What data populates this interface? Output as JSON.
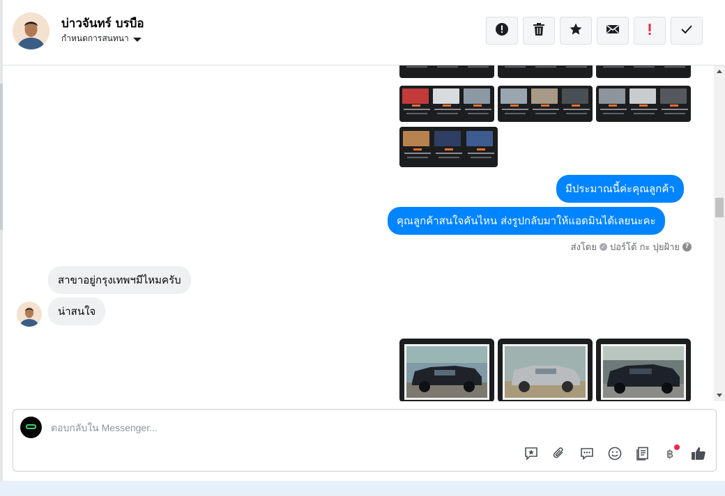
{
  "header": {
    "contact_name": "บ่าวจันทร์ บรบือ",
    "assign_label": "กำหนดการสนทนา",
    "tools": [
      {
        "name": "report-spam",
        "icon": "exclamation-circle-icon"
      },
      {
        "name": "delete",
        "icon": "trash-icon"
      },
      {
        "name": "star",
        "icon": "star-icon"
      },
      {
        "name": "mark-unread",
        "icon": "envelope-icon"
      },
      {
        "name": "follow-up",
        "icon": "red-exclamation-icon"
      },
      {
        "name": "mark-done",
        "icon": "checkmark-icon"
      }
    ]
  },
  "messages": {
    "outgoing_1": "มีประมาณนี้ค่ะคุณลูกค้า",
    "outgoing_2": "คุณลูกค้าสนใจคันไหน ส่งรูปกลับมาให้แอดมินได้เลยนะคะ",
    "sent_by_prefix": "ส่งโดย",
    "sent_by_name": "ปอร์โต้ กะ ปุยฝ้าย",
    "incoming_1": "สาขาอยู่กรุงเทพฯมีไหมครับ",
    "incoming_2": "น่าสนใจ"
  },
  "composer": {
    "placeholder": "ตอบกลับใน Messenger...",
    "tools": [
      "saved-reply-icon",
      "attachment-icon",
      "comment-icon",
      "emoji-icon",
      "notes-icon",
      "baht-payment-icon",
      "thumbs-up-icon"
    ]
  },
  "colors": {
    "outgoing_bubble": "#0084ff",
    "incoming_bubble": "#eff0f2",
    "follow_up_red": "#f02849"
  }
}
